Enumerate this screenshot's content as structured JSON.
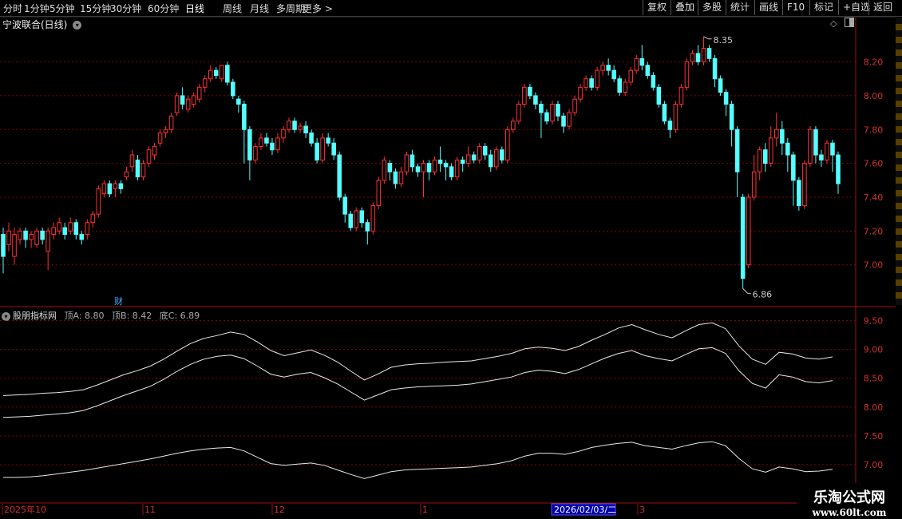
{
  "toolbar": {
    "periods": [
      "分时",
      "1分钟",
      "5分钟",
      "15分钟",
      "30分钟",
      "60分钟",
      "日线",
      "周线",
      "月线",
      "多周期",
      "更多 >"
    ],
    "active": "日线",
    "buttons": [
      "复权",
      "叠加",
      "多股",
      "统计",
      "画线",
      "F10",
      "标记",
      "+自选",
      "返回"
    ]
  },
  "main_chart": {
    "title": "宁波联合(日线)",
    "high_label": "8.35",
    "low_label": "6.86",
    "finance_marker": "财",
    "y_ticks": [
      "8.20",
      "8.00",
      "7.80",
      "7.60",
      "7.40",
      "7.20",
      "7.00"
    ]
  },
  "indicator": {
    "name": "股朋指标网",
    "values": [
      "顶A: 8.80",
      "顶B: 8.42",
      "底C: 6.89"
    ],
    "y_ticks": [
      "9.50",
      "9.00",
      "8.50",
      "8.00",
      "7.50",
      "7.00"
    ]
  },
  "date_axis": {
    "labels": [
      "2025年10",
      "11",
      "12",
      "1",
      "3"
    ],
    "cursor_date": "2026/02/03/二"
  },
  "watermark": {
    "title": "乐淘公式网",
    "url": "www.60lt.com"
  },
  "colors": {
    "up": "#ff3232",
    "down": "#54ffff",
    "grid": "#8b0000",
    "border": "#a01010"
  },
  "chart_data": {
    "type": "candlestick",
    "title": "宁波联合(日线)",
    "ylim": [
      6.85,
      8.4
    ],
    "candles": [
      [
        7.18,
        7.05,
        7.22,
        6.95
      ],
      [
        7.12,
        7.2,
        7.25,
        7.08
      ],
      [
        7.05,
        7.18,
        7.22,
        7.0
      ],
      [
        7.15,
        7.2,
        7.22,
        7.12
      ],
      [
        7.2,
        7.15,
        7.22,
        7.1
      ],
      [
        7.15,
        7.18,
        7.2,
        7.1
      ],
      [
        7.12,
        7.2,
        7.22,
        7.1
      ],
      [
        7.2,
        7.15,
        7.22,
        7.12
      ],
      [
        7.08,
        7.2,
        7.22,
        6.97
      ],
      [
        7.18,
        7.22,
        7.25,
        7.15
      ],
      [
        7.2,
        7.25,
        7.28,
        7.18
      ],
      [
        7.22,
        7.18,
        7.25,
        7.15
      ],
      [
        7.2,
        7.25,
        7.28,
        7.18
      ],
      [
        7.25,
        7.18,
        7.27,
        7.15
      ],
      [
        7.18,
        7.15,
        7.2,
        7.12
      ],
      [
        7.18,
        7.25,
        7.27,
        7.15
      ],
      [
        7.25,
        7.3,
        7.32,
        7.22
      ],
      [
        7.3,
        7.45,
        7.47,
        7.28
      ],
      [
        7.42,
        7.48,
        7.5,
        7.4
      ],
      [
        7.48,
        7.42,
        7.5,
        7.4
      ],
      [
        7.45,
        7.48,
        7.5,
        7.4
      ],
      [
        7.48,
        7.45,
        7.5,
        7.42
      ],
      [
        7.52,
        7.55,
        7.58,
        7.5
      ],
      [
        7.58,
        7.65,
        7.68,
        7.55
      ],
      [
        7.62,
        7.52,
        7.65,
        7.5
      ],
      [
        7.52,
        7.6,
        7.62,
        7.5
      ],
      [
        7.6,
        7.68,
        7.7,
        7.58
      ],
      [
        7.65,
        7.7,
        7.72,
        7.62
      ],
      [
        7.72,
        7.78,
        7.8,
        7.7
      ],
      [
        7.78,
        7.8,
        7.82,
        7.75
      ],
      [
        7.8,
        7.88,
        7.9,
        7.78
      ],
      [
        7.9,
        8.0,
        8.02,
        7.88
      ],
      [
        8.0,
        7.95,
        8.05,
        7.92
      ],
      [
        7.92,
        7.98,
        8.0,
        7.9
      ],
      [
        7.95,
        8.0,
        8.02,
        7.93
      ],
      [
        7.98,
        8.05,
        8.07,
        7.96
      ],
      [
        8.05,
        8.1,
        8.12,
        8.02
      ],
      [
        8.1,
        8.15,
        8.18,
        8.08
      ],
      [
        8.15,
        8.12,
        8.17,
        8.1
      ],
      [
        8.1,
        8.18,
        8.18,
        8.08
      ],
      [
        8.18,
        8.08,
        8.2,
        8.06
      ],
      [
        8.08,
        8.0,
        8.1,
        7.98
      ],
      [
        7.98,
        7.95,
        8.0,
        7.9
      ],
      [
        7.95,
        7.8,
        7.97,
        7.6
      ],
      [
        7.8,
        7.62,
        7.82,
        7.5
      ],
      [
        7.62,
        7.7,
        7.72,
        7.6
      ],
      [
        7.7,
        7.75,
        7.78,
        7.68
      ],
      [
        7.75,
        7.72,
        7.78,
        7.7
      ],
      [
        7.72,
        7.68,
        7.75,
        7.65
      ],
      [
        7.68,
        7.75,
        7.78,
        7.66
      ],
      [
        7.75,
        7.8,
        7.82,
        7.72
      ],
      [
        7.8,
        7.85,
        7.87,
        7.78
      ],
      [
        7.85,
        7.8,
        7.87,
        7.78
      ],
      [
        7.8,
        7.82,
        7.84,
        7.78
      ],
      [
        7.82,
        7.78,
        7.85,
        7.75
      ],
      [
        7.78,
        7.72,
        7.8,
        7.7
      ],
      [
        7.72,
        7.62,
        7.75,
        7.6
      ],
      [
        7.62,
        7.75,
        7.78,
        7.6
      ],
      [
        7.75,
        7.72,
        7.78,
        7.7
      ],
      [
        7.72,
        7.65,
        7.75,
        7.62
      ],
      [
        7.65,
        7.4,
        7.67,
        7.38
      ],
      [
        7.4,
        7.3,
        7.42,
        7.25
      ],
      [
        7.3,
        7.22,
        7.32,
        7.2
      ],
      [
        7.22,
        7.32,
        7.34,
        7.2
      ],
      [
        7.32,
        7.25,
        7.34,
        7.22
      ],
      [
        7.25,
        7.2,
        7.27,
        7.12
      ],
      [
        7.2,
        7.35,
        7.37,
        7.18
      ],
      [
        7.35,
        7.5,
        7.52,
        7.33
      ],
      [
        7.5,
        7.62,
        7.64,
        7.48
      ],
      [
        7.6,
        7.55,
        7.62,
        7.5
      ],
      [
        7.55,
        7.48,
        7.57,
        7.45
      ],
      [
        7.48,
        7.55,
        7.58,
        7.46
      ],
      [
        7.55,
        7.65,
        7.67,
        7.53
      ],
      [
        7.65,
        7.58,
        7.68,
        7.55
      ],
      [
        7.58,
        7.55,
        7.6,
        7.52
      ],
      [
        7.55,
        7.6,
        7.62,
        7.4
      ],
      [
        7.6,
        7.55,
        7.62,
        7.5
      ],
      [
        7.55,
        7.62,
        7.64,
        7.53
      ],
      [
        7.62,
        7.6,
        7.7,
        7.55
      ],
      [
        7.6,
        7.58,
        7.62,
        7.5
      ],
      [
        7.58,
        7.52,
        7.6,
        7.5
      ],
      [
        7.52,
        7.62,
        7.64,
        7.5
      ],
      [
        7.62,
        7.6,
        7.64,
        7.55
      ],
      [
        7.6,
        7.65,
        7.7,
        7.58
      ],
      [
        7.65,
        7.62,
        7.67,
        7.6
      ],
      [
        7.62,
        7.7,
        7.72,
        7.6
      ],
      [
        7.7,
        7.65,
        7.72,
        7.62
      ],
      [
        7.65,
        7.58,
        7.68,
        7.55
      ],
      [
        7.58,
        7.68,
        7.7,
        7.56
      ],
      [
        7.68,
        7.62,
        7.7,
        7.6
      ],
      [
        7.62,
        7.8,
        7.82,
        7.6
      ],
      [
        7.8,
        7.85,
        7.87,
        7.78
      ],
      [
        7.85,
        7.95,
        7.97,
        7.83
      ],
      [
        7.95,
        8.05,
        8.07,
        7.93
      ],
      [
        8.05,
        8.0,
        8.07,
        7.98
      ],
      [
        8.0,
        7.95,
        8.02,
        7.92
      ],
      [
        7.95,
        7.9,
        7.97,
        7.75
      ],
      [
        7.9,
        7.85,
        7.92,
        7.83
      ],
      [
        7.85,
        7.95,
        7.97,
        7.83
      ],
      [
        7.95,
        7.88,
        7.97,
        7.85
      ],
      [
        7.88,
        7.82,
        7.9,
        7.78
      ],
      [
        7.82,
        7.9,
        7.92,
        7.8
      ],
      [
        7.9,
        7.98,
        8.0,
        7.88
      ],
      [
        7.98,
        8.05,
        8.07,
        7.96
      ],
      [
        8.05,
        8.1,
        8.12,
        8.03
      ],
      [
        8.1,
        8.05,
        8.12,
        8.03
      ],
      [
        8.05,
        8.15,
        8.17,
        8.03
      ],
      [
        8.15,
        8.18,
        8.2,
        8.12
      ],
      [
        8.18,
        8.15,
        8.22,
        8.12
      ],
      [
        8.15,
        8.1,
        8.18,
        8.08
      ],
      [
        8.1,
        8.02,
        8.12,
        8.0
      ],
      [
        8.02,
        8.08,
        8.1,
        8.0
      ],
      [
        8.08,
        8.15,
        8.17,
        8.06
      ],
      [
        8.15,
        8.22,
        8.24,
        8.13
      ],
      [
        8.22,
        8.18,
        8.3,
        8.15
      ],
      [
        8.18,
        8.12,
        8.2,
        8.1
      ],
      [
        8.12,
        8.05,
        8.14,
        8.03
      ],
      [
        8.05,
        7.95,
        8.07,
        7.93
      ],
      [
        7.95,
        7.85,
        7.97,
        7.83
      ],
      [
        7.85,
        7.8,
        7.87,
        7.75
      ],
      [
        7.8,
        7.95,
        7.97,
        7.78
      ],
      [
        7.95,
        8.05,
        8.07,
        7.93
      ],
      [
        8.05,
        8.2,
        8.22,
        8.03
      ],
      [
        8.2,
        8.25,
        8.27,
        8.18
      ],
      [
        8.25,
        8.2,
        8.3,
        8.18
      ],
      [
        8.2,
        8.28,
        8.35,
        8.18
      ],
      [
        8.28,
        8.22,
        8.3,
        8.2
      ],
      [
        8.22,
        8.1,
        8.24,
        8.05
      ],
      [
        8.1,
        8.02,
        8.12,
        8.0
      ],
      [
        8.02,
        7.95,
        8.04,
        7.88
      ],
      [
        7.95,
        7.8,
        7.97,
        7.7
      ],
      [
        7.8,
        7.55,
        7.82,
        7.4
      ],
      [
        7.4,
        6.92,
        7.42,
        6.86
      ],
      [
        7.0,
        7.4,
        7.42,
        6.98
      ],
      [
        7.4,
        7.55,
        7.65,
        7.38
      ],
      [
        7.55,
        7.68,
        7.7,
        7.5
      ],
      [
        7.68,
        7.6,
        7.72,
        7.55
      ],
      [
        7.6,
        7.75,
        7.82,
        7.58
      ],
      [
        7.75,
        7.8,
        7.9,
        7.7
      ],
      [
        7.8,
        7.72,
        7.85,
        7.65
      ],
      [
        7.72,
        7.65,
        7.75,
        7.55
      ],
      [
        7.65,
        7.5,
        7.67,
        7.35
      ],
      [
        7.5,
        7.35,
        7.52,
        7.32
      ],
      [
        7.35,
        7.6,
        7.62,
        7.33
      ],
      [
        7.6,
        7.8,
        7.82,
        7.58
      ],
      [
        7.8,
        7.65,
        7.82,
        7.6
      ],
      [
        7.65,
        7.62,
        7.68,
        7.58
      ],
      [
        7.62,
        7.72,
        7.74,
        7.6
      ],
      [
        7.72,
        7.65,
        7.74,
        7.55
      ],
      [
        7.65,
        7.48,
        7.67,
        7.42
      ]
    ],
    "indicator_series": [
      {
        "name": "顶A",
        "values": [
          8.2,
          8.21,
          8.22,
          8.24,
          8.25,
          8.27,
          8.3,
          8.38,
          8.47,
          8.56,
          8.63,
          8.71,
          8.83,
          8.97,
          9.1,
          9.19,
          9.24,
          9.3,
          9.26,
          9.13,
          8.98,
          8.89,
          8.94,
          8.99,
          8.9,
          8.78,
          8.62,
          8.47,
          8.57,
          8.69,
          8.73,
          8.75,
          8.76,
          8.78,
          8.79,
          8.8,
          8.84,
          8.88,
          8.93,
          9.01,
          9.04,
          9.02,
          8.98,
          9.05,
          9.16,
          9.26,
          9.37,
          9.43,
          9.34,
          9.26,
          9.2,
          9.32,
          9.43,
          9.46,
          9.36,
          9.06,
          8.83,
          8.74,
          8.95,
          8.92,
          8.85,
          8.83,
          8.87
        ]
      },
      {
        "name": "顶B",
        "values": [
          7.82,
          7.83,
          7.84,
          7.86,
          7.88,
          7.9,
          7.94,
          8.02,
          8.11,
          8.2,
          8.28,
          8.36,
          8.48,
          8.62,
          8.74,
          8.83,
          8.88,
          8.9,
          8.84,
          8.71,
          8.57,
          8.52,
          8.57,
          8.6,
          8.51,
          8.4,
          8.26,
          8.12,
          8.21,
          8.3,
          8.33,
          8.35,
          8.36,
          8.37,
          8.38,
          8.4,
          8.44,
          8.48,
          8.52,
          8.6,
          8.64,
          8.62,
          8.58,
          8.65,
          8.75,
          8.85,
          8.93,
          8.98,
          8.89,
          8.84,
          8.8,
          8.91,
          9.01,
          9.03,
          8.93,
          8.63,
          8.41,
          8.33,
          8.56,
          8.52,
          8.44,
          8.42,
          8.46
        ]
      },
      {
        "name": "底C",
        "values": [
          6.78,
          6.78,
          6.79,
          6.81,
          6.84,
          6.87,
          6.9,
          6.94,
          6.98,
          7.02,
          7.06,
          7.1,
          7.15,
          7.2,
          7.24,
          7.27,
          7.29,
          7.3,
          7.24,
          7.13,
          7.02,
          6.99,
          7.01,
          7.03,
          6.99,
          6.91,
          6.83,
          6.76,
          6.82,
          6.88,
          6.91,
          6.92,
          6.93,
          6.94,
          6.95,
          6.96,
          6.99,
          7.02,
          7.07,
          7.15,
          7.2,
          7.2,
          7.18,
          7.23,
          7.3,
          7.34,
          7.37,
          7.39,
          7.33,
          7.3,
          7.27,
          7.33,
          7.38,
          7.4,
          7.33,
          7.11,
          6.93,
          6.87,
          6.96,
          6.93,
          6.88,
          6.89,
          6.92
        ]
      }
    ],
    "indicator_ylim": [
      6.75,
      9.6
    ]
  }
}
